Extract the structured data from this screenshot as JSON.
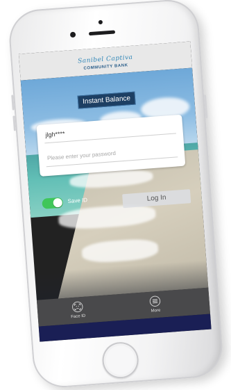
{
  "brand": {
    "script_name": "Sanibel Captiva",
    "caps_name": "COMMUNITY BANK"
  },
  "banner": {
    "instant_balance_label": "Instant Balance"
  },
  "login": {
    "username_value": "jlgh****",
    "password_placeholder": "Please enter your password",
    "save_id_label": "Save ID",
    "save_id_on": true,
    "login_button_label": "Log In"
  },
  "tabbar": {
    "items": [
      {
        "label": "Face ID",
        "icon": "face-id-icon"
      },
      {
        "label": "More",
        "icon": "menu-icon"
      }
    ]
  },
  "colors": {
    "toggle_on": "#3fc65a",
    "banner_bg": "#1d3f63",
    "tabbar_bg": "#49494b",
    "strip_bg": "#1a1f55"
  }
}
